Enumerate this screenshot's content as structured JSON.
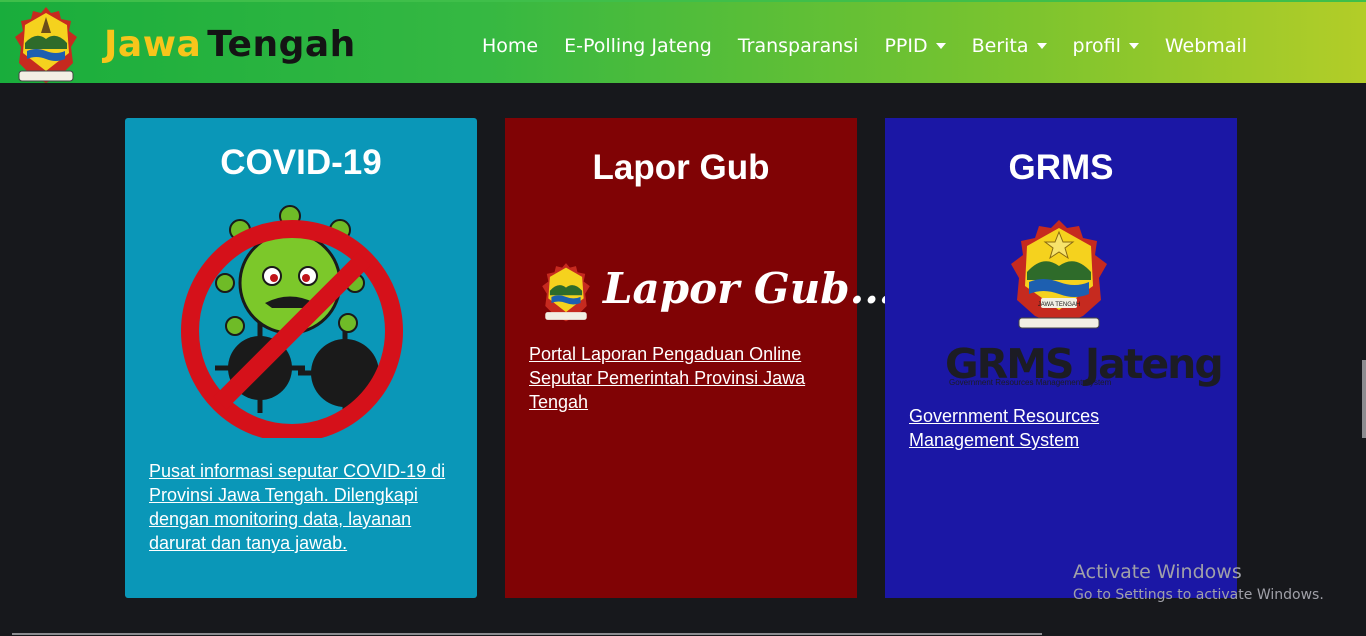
{
  "header": {
    "brand_part1": "Jawa",
    "brand_part2": "Tengah",
    "logo_icon": "jawa-tengah-crest",
    "gradient_colors": [
      "#19ad3c",
      "#b3cd28"
    ]
  },
  "nav": {
    "home": "Home",
    "polling": "E-Polling Jateng",
    "transparansi": "Transparansi",
    "ppid": "PPID",
    "berita": "Berita",
    "profil": "profil",
    "webmail": "Webmail"
  },
  "cards": {
    "covid": {
      "title": "COVID-19",
      "icon": "virus-prohibited-icon",
      "color": "#0a97b8",
      "link": "Pusat informasi seputar COVID-19 di Provinsi Jawa Tengah. Dilengkapi dengan monitoring data, layanan darurat dan tanya jawab."
    },
    "lapor": {
      "title": "Lapor Gub",
      "logo_text": "Lapor Gub..!",
      "color": "#800305",
      "link": "Portal Laporan Pengaduan Online Seputar Pemerintah Provinsi Jawa Tengah"
    },
    "grms": {
      "title": "GRMS",
      "logo_text": "GRMS Jateng",
      "logo_subtext": "Government Resources Management System",
      "crest_banner": "JAWA TENGAH",
      "color": "#1b17a5",
      "link": "Government Resources Management System"
    }
  },
  "windows": {
    "activate_title": "Activate Windows",
    "activate_sub": "Go to Settings to activate Windows."
  }
}
